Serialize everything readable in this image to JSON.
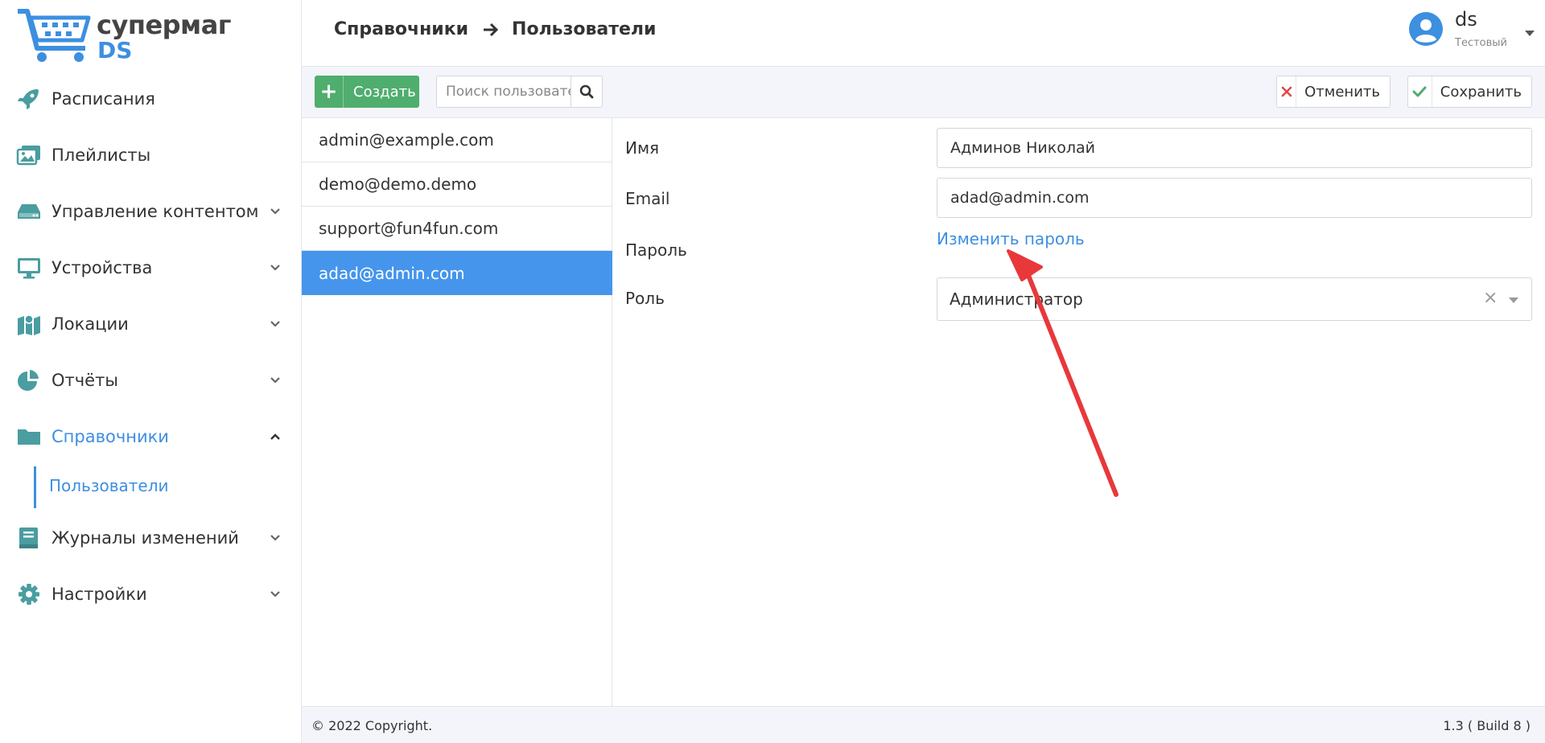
{
  "brand": {
    "name": "супермаг",
    "sub": "DS"
  },
  "menu": {
    "items": [
      {
        "label": "Расписания",
        "icon": "rocket-icon",
        "chevron": false
      },
      {
        "label": "Плейлисты",
        "icon": "images-icon",
        "chevron": false
      },
      {
        "label": "Управление контентом",
        "icon": "hdd-icon",
        "chevron": true
      },
      {
        "label": "Устройства",
        "icon": "desktop-icon",
        "chevron": true
      },
      {
        "label": "Локации",
        "icon": "map-icon",
        "chevron": true
      },
      {
        "label": "Отчёты",
        "icon": "pie-chart-icon",
        "chevron": true
      },
      {
        "label": "Справочники",
        "icon": "folder-icon",
        "chevron": "up",
        "active": true
      },
      {
        "label": "Журналы изменений",
        "icon": "book-icon",
        "chevron": true
      },
      {
        "label": "Настройки",
        "icon": "gear-icon",
        "chevron": true
      }
    ],
    "submenu": {
      "label": "Пользователи"
    }
  },
  "header": {
    "breadcrumb": [
      "Справочники",
      "Пользователи"
    ],
    "user": {
      "name": "ds",
      "role": "Тестовый"
    }
  },
  "list": {
    "create_label": "Создать",
    "search_placeholder": "Поиск пользователей",
    "users": [
      "admin@example.com",
      "demo@demo.demo",
      "support@fun4fun.com",
      "adad@admin.com"
    ],
    "selected_index": 3
  },
  "detail": {
    "cancel_label": "Отменить",
    "save_label": "Сохранить",
    "fields": {
      "name_label": "Имя",
      "name_value": "Админов Николай",
      "email_label": "Email",
      "email_value": "adad@admin.com",
      "password_label": "Пароль",
      "password_link": "Изменить пароль",
      "role_label": "Роль",
      "role_value": "Администратор"
    }
  },
  "footer": {
    "copyright": "© 2022 Copyright.",
    "version": "1.3 ( Build 8 )"
  },
  "colors": {
    "accent": "#3d8fe0",
    "green": "#4fad6e",
    "icon": "#4a9da0",
    "selected": "#4595ec",
    "arrow": "#e8383a"
  }
}
